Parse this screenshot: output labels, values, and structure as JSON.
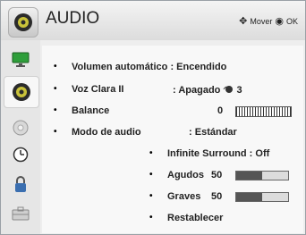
{
  "header": {
    "title": "AUDIO",
    "hint": "Mover",
    "ok": "OK"
  },
  "sidebar": {
    "tabs": [
      "picture-icon",
      "audio-icon",
      "setup-icon",
      "time-icon",
      "lock-icon",
      "options-icon"
    ],
    "active": 1
  },
  "settings": [
    {
      "label": "Volumen automático",
      "sep": ":",
      "value": "Encendido"
    },
    {
      "label": "Voz Clara II",
      "sep": ":",
      "value": "Apagado",
      "extra": "3"
    },
    {
      "label": "Balance",
      "value": "0"
    },
    {
      "label": "Modo de audio",
      "sep": ":",
      "value": "Estándar"
    }
  ],
  "sub": {
    "surround_label": "Infinite Surround",
    "surround_value": "Off",
    "agudos_label": "Agudos",
    "agudos_value": "50",
    "graves_label": "Graves",
    "graves_value": "50",
    "reset_label": "Restablecer"
  },
  "levels": {
    "agudos": 0.5,
    "graves": 0.5
  }
}
